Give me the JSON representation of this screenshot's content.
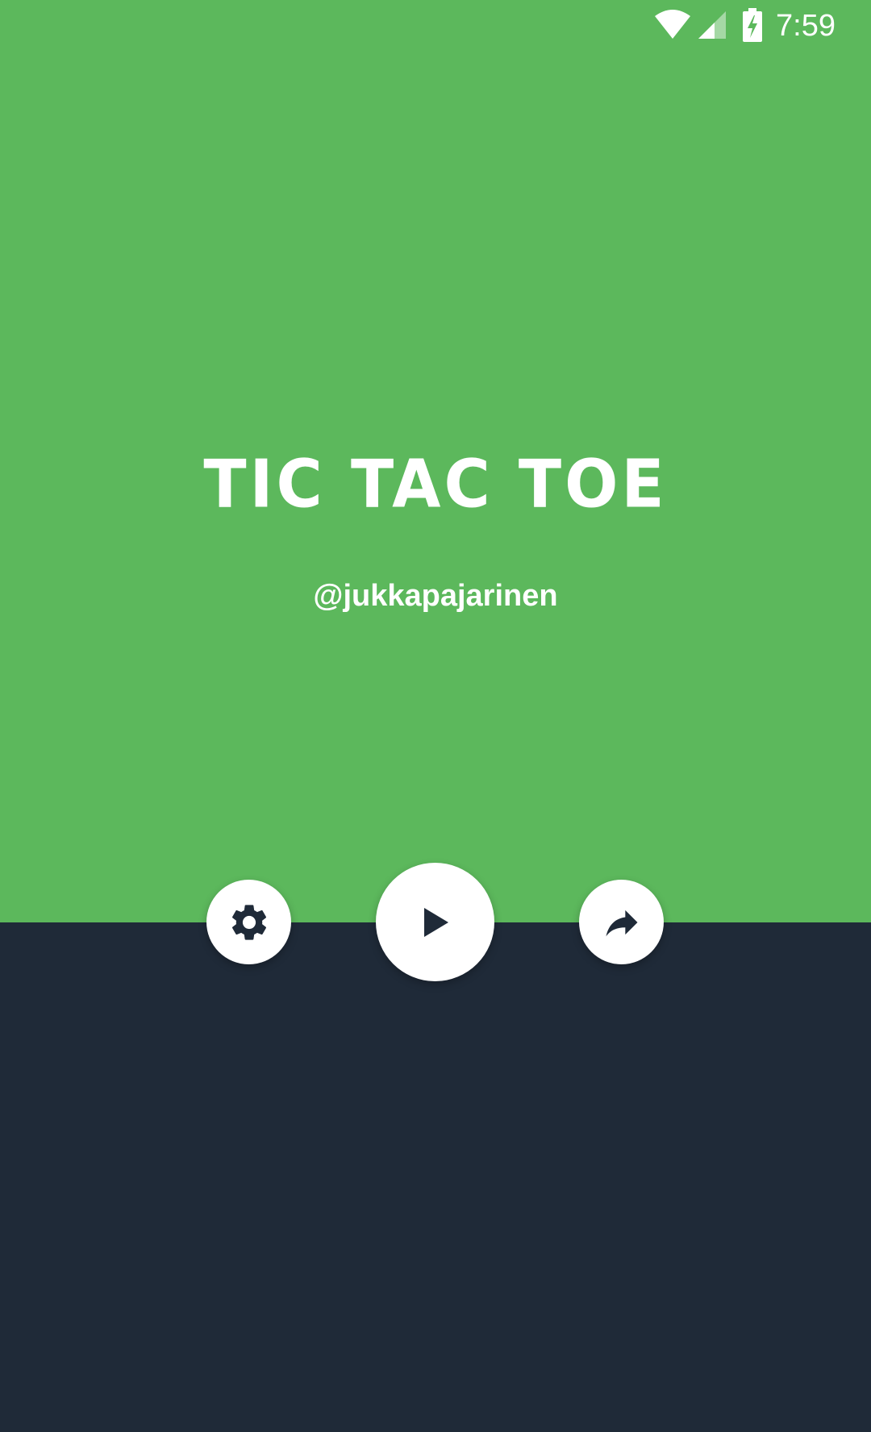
{
  "status_bar": {
    "time": "7:59",
    "icons": [
      "wifi-icon",
      "cell-signal-icon",
      "battery-charging-icon"
    ]
  },
  "app": {
    "title": "TIC TAC TOE",
    "author": "@jukkapajarinen"
  },
  "buttons": {
    "settings_icon": "gear-icon",
    "play_icon": "play-icon",
    "share_icon": "share-arrow-icon"
  },
  "colors": {
    "top_background": "#5cb85c",
    "bottom_background": "#1f2a38",
    "button_background": "#ffffff",
    "icon_color": "#1f2a38",
    "text_color": "#ffffff"
  }
}
